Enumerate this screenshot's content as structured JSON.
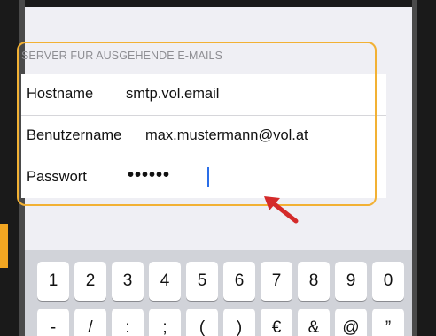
{
  "section": {
    "header": "SERVER FÜR AUSGEHENDE E-MAILS"
  },
  "fields": [
    {
      "label": "Hostname",
      "value": "smtp.vol.email"
    },
    {
      "label": "Benutzername",
      "value": "max.mustermann@vol.at"
    },
    {
      "label": "Passwort",
      "value": "••••••"
    }
  ],
  "keyboard": {
    "row1": [
      "1",
      "2",
      "3",
      "4",
      "5",
      "6",
      "7",
      "8",
      "9",
      "0"
    ],
    "row2": [
      "-",
      "/",
      ":",
      ";",
      "(",
      ")",
      "€",
      "&",
      "@",
      "”"
    ]
  },
  "colors": {
    "highlight": "#f2b134",
    "arrow": "#d42a2a",
    "cursor": "#2a6ee8"
  },
  "icons": {
    "pointer": "arrow-icon"
  }
}
